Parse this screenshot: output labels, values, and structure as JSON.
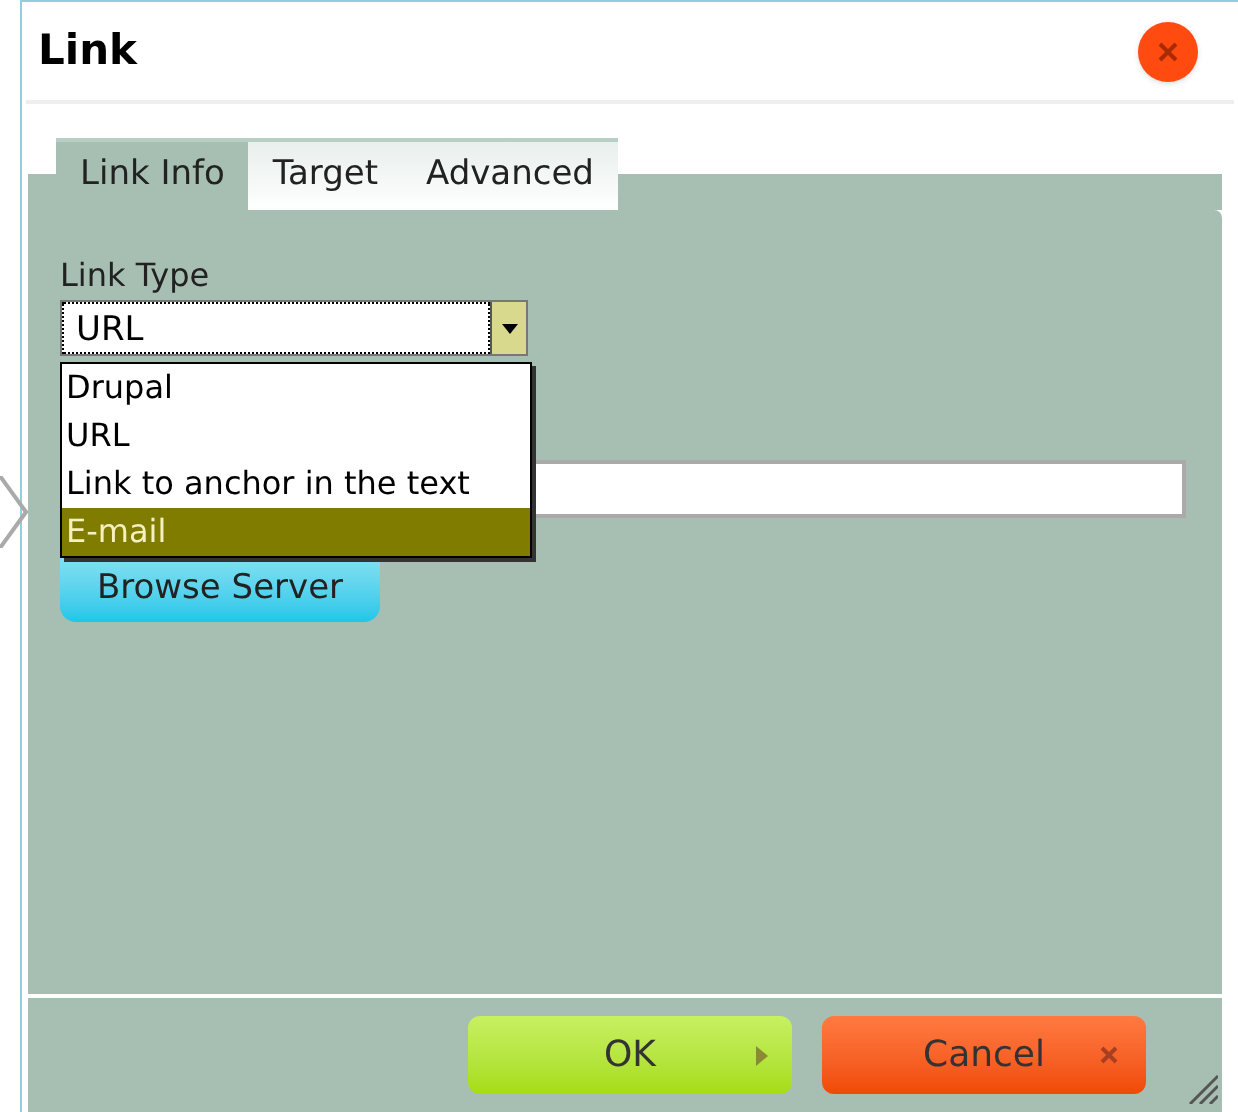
{
  "window": {
    "title": "Link"
  },
  "tabs": [
    {
      "label": "Link Info",
      "selected": true
    },
    {
      "label": "Target",
      "selected": false
    },
    {
      "label": "Advanced",
      "selected": false
    }
  ],
  "link_type": {
    "label": "Link Type",
    "value": "URL",
    "expanded": true,
    "options": [
      {
        "label": "Drupal",
        "highlighted": false
      },
      {
        "label": "URL",
        "highlighted": false
      },
      {
        "label": "Link to anchor in the text",
        "highlighted": false
      },
      {
        "label": "E-mail",
        "highlighted": true
      }
    ]
  },
  "browse_button": "Browse Server",
  "buttons": [
    {
      "label": "OK",
      "kind": "ok"
    },
    {
      "label": "Cancel",
      "kind": "cancel"
    }
  ]
}
